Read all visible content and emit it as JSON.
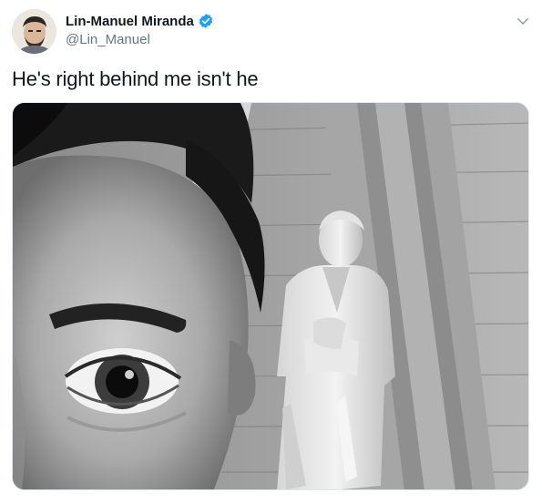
{
  "tweet": {
    "author": {
      "display_name": "Lin-Manuel Miranda",
      "handle": "@Lin_Manuel",
      "verified": true,
      "avatar_icon": "person-avatar-icon"
    },
    "text": "He's right behind me isn't he",
    "menu_icon": "chevron-down-icon",
    "media": {
      "type": "photo",
      "style": "black-and-white"
    }
  },
  "colors": {
    "verified_badge": "#1da1f2",
    "handle_text": "#657786",
    "primary_text": "#14171a"
  }
}
